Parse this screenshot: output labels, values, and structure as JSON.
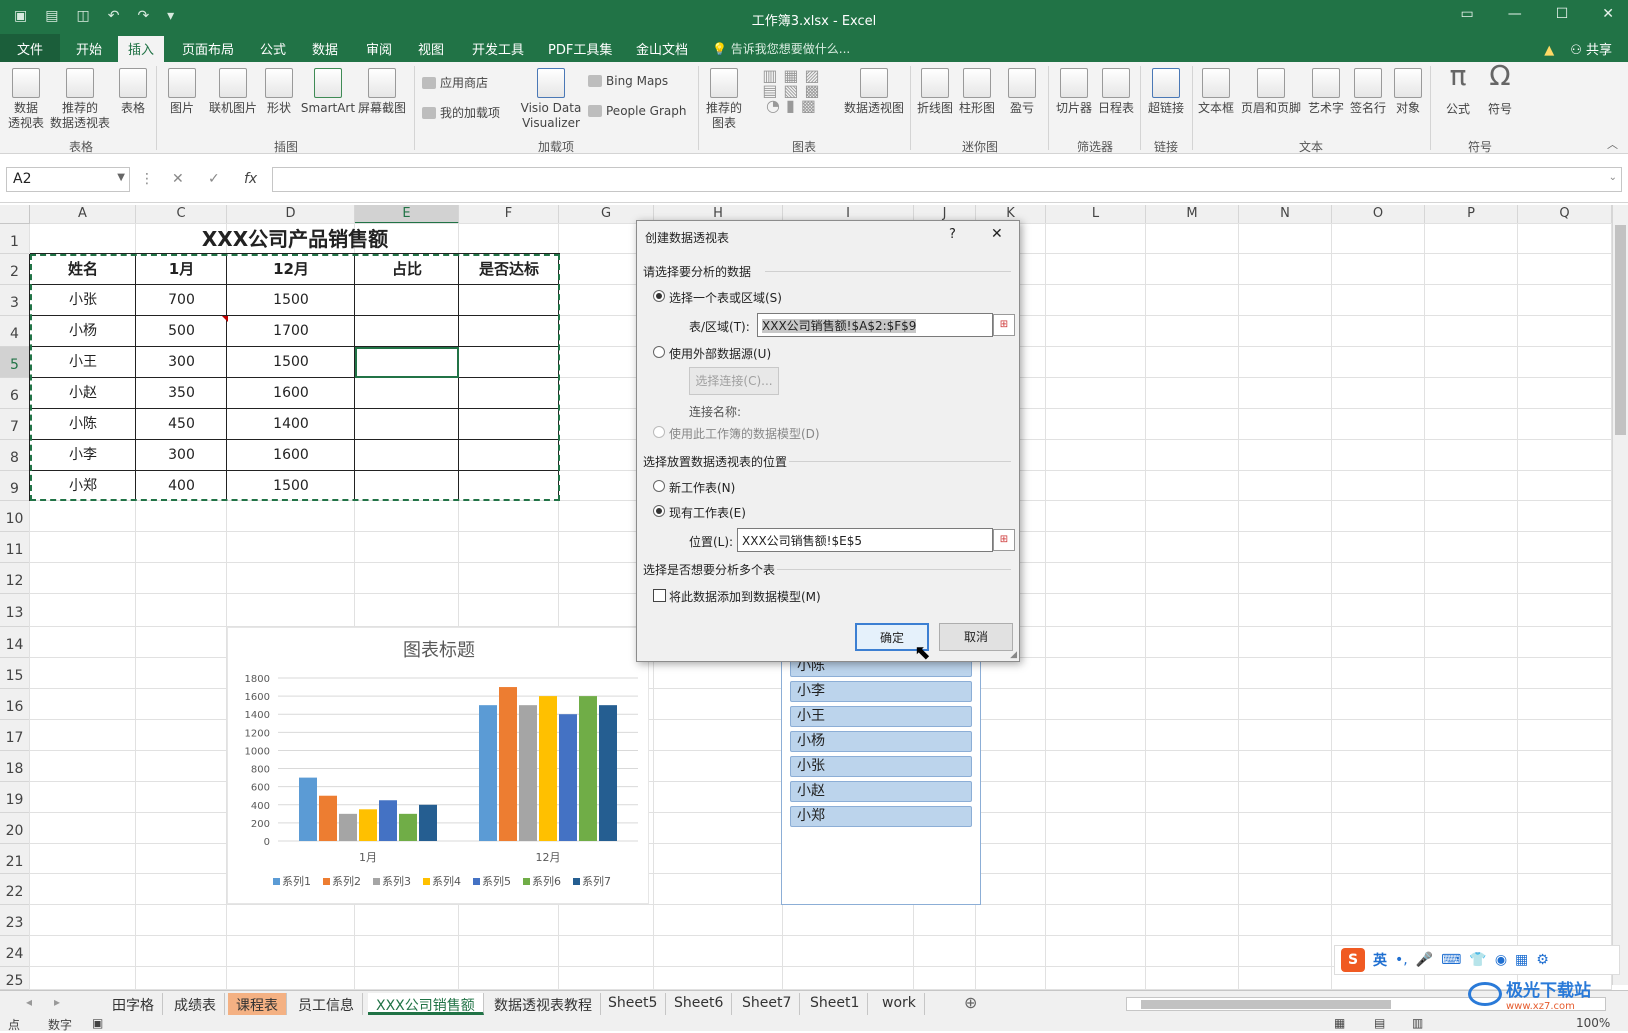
{
  "window": {
    "title": "工作簿3.xlsx - Excel"
  },
  "tabs": [
    "文件",
    "开始",
    "插入",
    "页面布局",
    "公式",
    "数据",
    "审阅",
    "视图",
    "开发工具",
    "PDF工具集",
    "金山文档"
  ],
  "tellme": "告诉我您想要做什么...",
  "share": "共享",
  "ribbon": {
    "btns": [
      "数据\n透视表",
      "推荐的\n数据透视表",
      "表格",
      "图片",
      "联机图片",
      "形状",
      "SmartArt",
      "屏幕截图",
      "Visio Data\nVisualizer",
      "推荐的\n图表",
      "数据透视图",
      "折线图",
      "柱形图",
      "盈亏",
      "切片器",
      "日程表",
      "超链接",
      "文本框",
      "页眉和页脚",
      "艺术字",
      "签名行",
      "对象",
      "公式",
      "符号"
    ],
    "small": [
      "应用商店",
      "我的加载项",
      "Bing Maps",
      "People Graph"
    ],
    "groups": [
      "表格",
      "插图",
      "加载项",
      "图表",
      "迷你图",
      "筛选器",
      "链接",
      "文本",
      "符号"
    ]
  },
  "namebox": "A2",
  "fx": "fx",
  "columns": [
    "A",
    "C",
    "D",
    "E",
    "F",
    "G",
    "H",
    "I",
    "J",
    "K",
    "L",
    "M",
    "N",
    "O",
    "P",
    "Q"
  ],
  "rows": [
    "1",
    "2",
    "3",
    "4",
    "5",
    "6",
    "7",
    "8",
    "9",
    "10",
    "11",
    "12",
    "13",
    "14",
    "15",
    "16",
    "17",
    "18",
    "19",
    "20",
    "21",
    "22",
    "23",
    "24",
    "25"
  ],
  "table": {
    "title": "XXX公司产品销售额",
    "headers": [
      "姓名",
      "1月",
      "12月",
      "占比",
      "是否达标"
    ],
    "rows": [
      [
        "小张",
        "700",
        "1500"
      ],
      [
        "小杨",
        "500",
        "1700"
      ],
      [
        "小王",
        "300",
        "1500"
      ],
      [
        "小赵",
        "350",
        "1600"
      ],
      [
        "小陈",
        "450",
        "1400"
      ],
      [
        "小李",
        "300",
        "1600"
      ],
      [
        "小郑",
        "400",
        "1500"
      ]
    ]
  },
  "chart_data": {
    "type": "bar",
    "title": "图表标题",
    "categories": [
      "1月",
      "12月"
    ],
    "ylim": [
      0,
      1800
    ],
    "yticks": [
      "0",
      "200",
      "400",
      "600",
      "800",
      "1000",
      "1200",
      "1400",
      "1600",
      "1800"
    ],
    "legend_position": "bottom",
    "colors": [
      "#5b9bd5",
      "#ed7d31",
      "#a5a5a5",
      "#ffc000",
      "#4472c4",
      "#70ad47",
      "#255e91"
    ],
    "series": [
      {
        "name": "系列1",
        "values": [
          700,
          1500
        ]
      },
      {
        "name": "系列2",
        "values": [
          500,
          1700
        ]
      },
      {
        "name": "系列3",
        "values": [
          300,
          1500
        ]
      },
      {
        "name": "系列4",
        "values": [
          350,
          1600
        ]
      },
      {
        "name": "系列5",
        "values": [
          450,
          1400
        ]
      },
      {
        "name": "系列6",
        "values": [
          300,
          1600
        ]
      },
      {
        "name": "系列7",
        "values": [
          400,
          1500
        ]
      }
    ]
  },
  "slicer": [
    "小陈",
    "小李",
    "小王",
    "小杨",
    "小张",
    "小赵",
    "小郑"
  ],
  "dialog": {
    "title": "创建数据透视表",
    "help": "?",
    "close": "✕",
    "sec1": "请选择要分析的数据",
    "opt1": "选择一个表或区域(S)",
    "range_label": "表/区域(T):",
    "range_value": "XXX公司销售额!$A$2:$F$9",
    "opt2": "使用外部数据源(U)",
    "choose_conn": "选择连接(C)...",
    "conn_name": "连接名称:",
    "opt3": "使用此工作簿的数据模型(D)",
    "sec2": "选择放置数据透视表的位置",
    "opt4": "新工作表(N)",
    "opt5": "现有工作表(E)",
    "loc_label": "位置(L):",
    "loc_value": "XXX公司销售额!$E$5",
    "sec3": "选择是否想要分析多个表",
    "chk": "将此数据添加到数据模型(M)",
    "ok": "确定",
    "cancel": "取消"
  },
  "sheets": [
    "田字格",
    "成绩表",
    "课程表",
    "员工信息",
    "XXX公司销售额",
    "数据透视表教程",
    "Sheet5",
    "Sheet6",
    "Sheet7",
    "Sheet1",
    "work"
  ],
  "status": {
    "left": "点",
    "mode": "数字",
    "zoom": "100%"
  },
  "ime": "英",
  "watermark": "极光下载站",
  "watermark_url": "www.xz7.com"
}
